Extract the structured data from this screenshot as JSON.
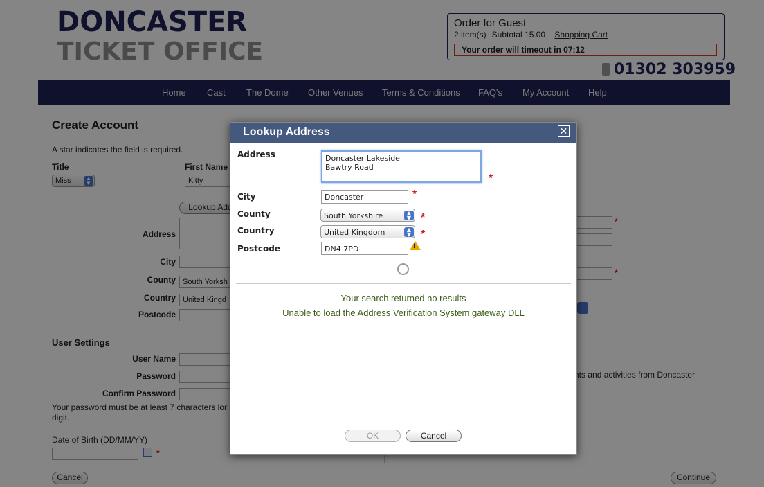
{
  "header": {
    "logo_line1": "DONCASTER",
    "logo_line2": "TICKET OFFICE",
    "order_title": "Order for Guest",
    "items": "2 item(s)",
    "subtotal": "Subtotal 15.00",
    "cart_link": "Shopping Cart",
    "timeout": "Your order will timeout in 07:12",
    "phone": "01302 303959"
  },
  "nav": [
    "Home",
    "Cast",
    "The Dome",
    "Other Venues",
    "Terms & Conditions",
    "FAQ's",
    "My Account",
    "Help"
  ],
  "form": {
    "title": "Create Account",
    "required_note": "A star indicates the field is required.",
    "title_label": "Title",
    "title_value": "Miss",
    "first_name_label": "First Name",
    "first_name_value": "Kitty",
    "lookup_button": "Lookup Add",
    "address_label": "Address",
    "city_label": "City",
    "county_label": "County",
    "county_value": "South Yorksh",
    "country_label": "Country",
    "country_value": "United Kingd",
    "postcode_label": "Postcode",
    "user_settings": "User Settings",
    "username_label": "User Name",
    "password_label": "Password",
    "confirm_label": "Confirm Password",
    "password_note_1": "Your password must be at least 7 characters lor",
    "password_note_2": "digit.",
    "dob_label": "Date of Birth (DD/MM/YY)",
    "cancel": "Cancel",
    "continue": "Continue",
    "marketing_text": "nts and activities from Doncaster"
  },
  "dialog": {
    "title": "Lookup Address",
    "close": "✕",
    "address_label": "Address",
    "address_line1": "Doncaster Lakeside",
    "address_line2": "Bawtry Road",
    "city_label": "City",
    "city_value": "Doncaster",
    "county_label": "County",
    "county_value": "South Yorkshire",
    "country_label": "Country",
    "country_value": "United Kingdom",
    "postcode_label": "Postcode",
    "postcode_value": "DN4 7PD",
    "message1": "Your search returned no results",
    "message2": "Unable to load the Address Verification System gateway DLL",
    "ok": "OK",
    "cancel": "Cancel"
  },
  "colors": {
    "brand": "#1e2157",
    "dialog_header": "#44597d",
    "message": "#3b5e1a",
    "required": "#d21e1e"
  }
}
